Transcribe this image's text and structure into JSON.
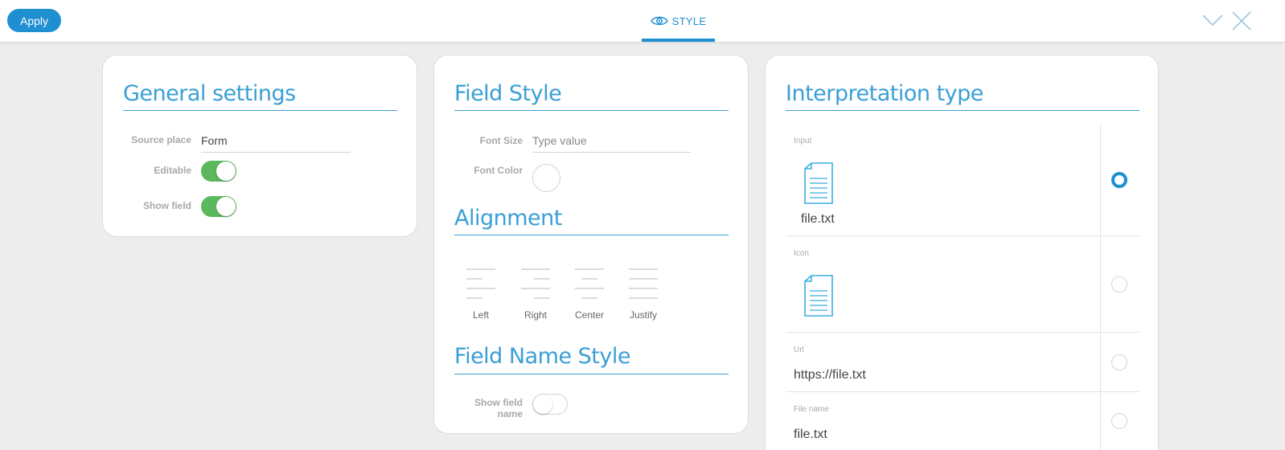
{
  "toolbar": {
    "apply_label": "Apply",
    "tab_label": "STYLE",
    "tab_icon": "eye-icon",
    "collapse_icon": "chevron-down-icon",
    "close_icon": "close-icon",
    "accent_color": "#1e8fd0"
  },
  "general": {
    "title": "General settings",
    "source_place_label": "Source place",
    "source_place_value": "Form",
    "editable_label": "Editable",
    "editable_on": true,
    "show_field_label": "Show field",
    "show_field_on": true
  },
  "field_style": {
    "title": "Field Style",
    "font_size_label": "Font Size",
    "font_size_placeholder": "Type value",
    "font_color_label": "Font Color"
  },
  "alignment": {
    "title": "Alignment",
    "options": [
      {
        "label": "Left"
      },
      {
        "label": "Right"
      },
      {
        "label": "Center"
      },
      {
        "label": "Justify"
      }
    ]
  },
  "field_name_style": {
    "title": "Field Name Style",
    "show_field_name_label_line1": "Show field",
    "show_field_name_label_line2": "name",
    "show_field_name_on": false
  },
  "interpretation": {
    "title": "Interpretation type",
    "selected": "Input",
    "options": [
      {
        "label": "Input",
        "value": "file.txt",
        "icon": "file-icon"
      },
      {
        "label": "Icon",
        "icon": "file-icon"
      },
      {
        "label": "Url",
        "value": "https://file.txt"
      },
      {
        "label": "File name",
        "value": "file.txt"
      }
    ]
  },
  "colors": {
    "toggle_on": "#5cb85c",
    "title_blue": "#3a9fd6",
    "background": "#ededee"
  }
}
